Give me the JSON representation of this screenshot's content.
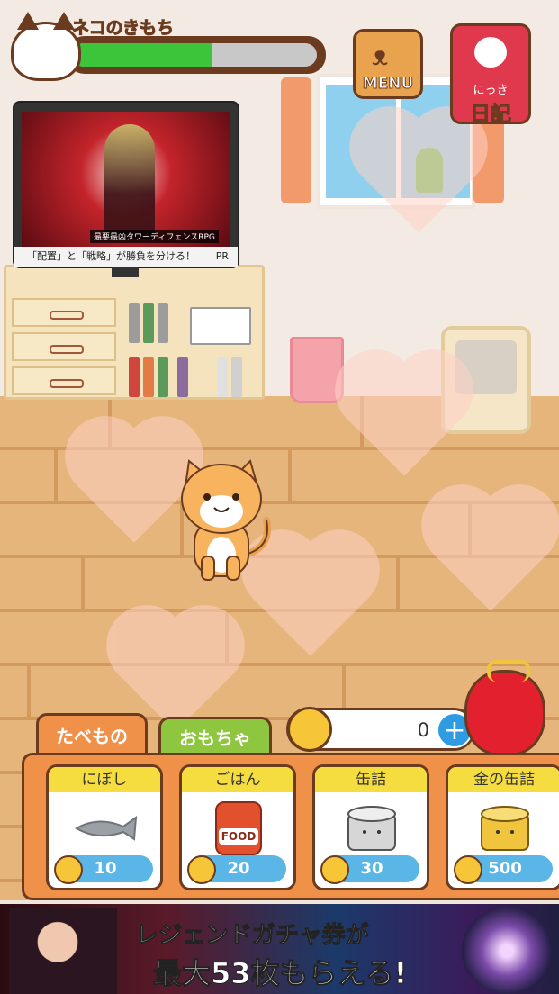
{
  "hud": {
    "mood_title": "ネコのきもち",
    "mood_level": 0.57,
    "menu_label": "MENU",
    "diary_small": "にっき",
    "diary_big": "日記"
  },
  "tv": {
    "ad_title": "最悪最凶タワーディフェンスRPG",
    "caption": "「配置」と「戦略」が勝負を分ける！",
    "pr_label": "PR"
  },
  "tabs": {
    "food": "たべもの",
    "toys": "おもちゃ"
  },
  "wallet": {
    "coins": "0",
    "add_symbol": "+"
  },
  "food_items": [
    {
      "name": "にぼし",
      "price": "10",
      "icon": "dried-fish-icon"
    },
    {
      "name": "ごはん",
      "price": "20",
      "icon": "food-bag-icon",
      "pic_label": "FOOD"
    },
    {
      "name": "缶詰",
      "price": "30",
      "icon": "cat-can-icon"
    },
    {
      "name": "金の缶詰",
      "price": "500",
      "icon": "gold-cat-can-icon"
    }
  ],
  "banner": {
    "line1": "レジェンドガチャ券が",
    "line2": "最大53枚もらえる!"
  },
  "colors": {
    "accent_orange": "#f0914a",
    "toy_green": "#8fc640",
    "outline_brown": "#6b3b1f",
    "mood_green": "#3cc43a",
    "price_blue": "#5ab6e7"
  }
}
